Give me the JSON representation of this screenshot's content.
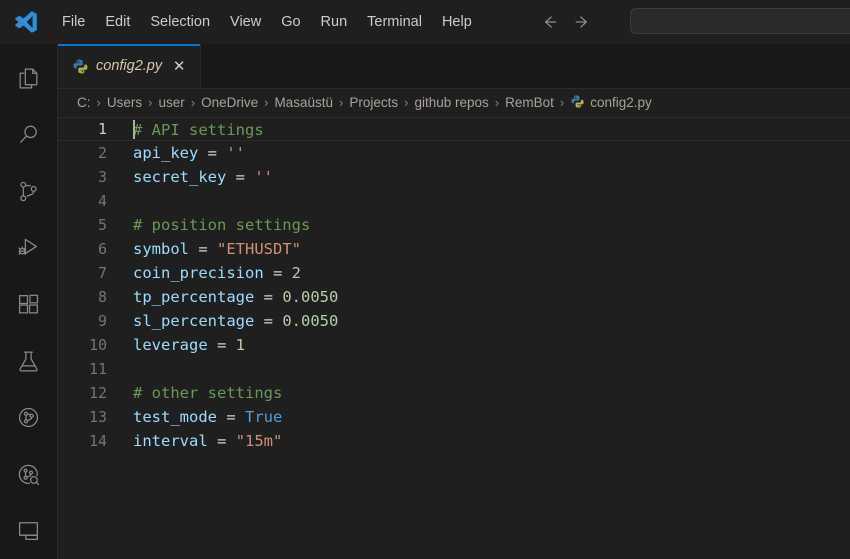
{
  "window": {
    "app_logo_icon": "vscode-logo-icon",
    "title": "config2.py"
  },
  "menubar": {
    "items": [
      {
        "label": "File",
        "name": "menu-file"
      },
      {
        "label": "Edit",
        "name": "menu-edit"
      },
      {
        "label": "Selection",
        "name": "menu-selection"
      },
      {
        "label": "View",
        "name": "menu-view"
      },
      {
        "label": "Go",
        "name": "menu-go"
      },
      {
        "label": "Run",
        "name": "menu-run"
      },
      {
        "label": "Terminal",
        "name": "menu-terminal"
      },
      {
        "label": "Help",
        "name": "menu-help"
      }
    ]
  },
  "navigation": {
    "back_icon": "arrow-left-icon",
    "forward_icon": "arrow-right-icon"
  },
  "search": {
    "value": "",
    "placeholder": ""
  },
  "activitybar": {
    "items": [
      {
        "name": "activity-explorer",
        "icon": "files-icon",
        "label": "Explorer",
        "active": false
      },
      {
        "name": "activity-search",
        "icon": "search-icon",
        "label": "Search",
        "active": false
      },
      {
        "name": "activity-source-control",
        "icon": "source-control-icon",
        "label": "Source Control",
        "active": false
      },
      {
        "name": "activity-run-debug",
        "icon": "run-and-debug-icon",
        "label": "Run and Debug",
        "active": false
      },
      {
        "name": "activity-extensions",
        "icon": "extensions-icon",
        "label": "Extensions",
        "active": false
      },
      {
        "name": "activity-testing",
        "icon": "beaker-icon",
        "label": "Testing",
        "active": false
      },
      {
        "name": "activity-git-graph",
        "icon": "git-graph-icon",
        "label": "Git Graph",
        "active": false
      },
      {
        "name": "activity-git-search",
        "icon": "git-search-icon",
        "label": "Search & Compare",
        "active": false
      },
      {
        "name": "activity-panel",
        "icon": "panel-icon",
        "label": "Panel",
        "active": false
      }
    ]
  },
  "tabs": [
    {
      "name": "tab-config2-py",
      "label": "config2.py",
      "icon": "python-file-icon",
      "close_icon": "close-icon",
      "close_glyph": "✕",
      "active": true
    }
  ],
  "breadcrumb": {
    "separator": "›",
    "items": [
      {
        "label": "C:",
        "icon": null
      },
      {
        "label": "Users",
        "icon": null
      },
      {
        "label": "user",
        "icon": null
      },
      {
        "label": "OneDrive",
        "icon": null
      },
      {
        "label": "Masaüstü",
        "icon": null
      },
      {
        "label": "Projects",
        "icon": null
      },
      {
        "label": "github repos",
        "icon": null
      },
      {
        "label": "RemBot",
        "icon": null
      },
      {
        "label": "config2.py",
        "icon": "python-file-icon"
      }
    ]
  },
  "editor": {
    "language": "python",
    "file_name": "config2.py",
    "cursor_line": 1,
    "cursor_column": 1,
    "lines": [
      {
        "num": "1",
        "current": true,
        "tokens": [
          {
            "t": "# API settings",
            "c": "comment"
          }
        ]
      },
      {
        "num": "2",
        "current": false,
        "tokens": [
          {
            "t": "api_key",
            "c": "var"
          },
          {
            "t": " = ",
            "c": "op"
          },
          {
            "t": "''",
            "c": "string"
          }
        ]
      },
      {
        "num": "3",
        "current": false,
        "tokens": [
          {
            "t": "secret_key",
            "c": "var"
          },
          {
            "t": " = ",
            "c": "op"
          },
          {
            "t": "''",
            "c": "string"
          }
        ]
      },
      {
        "num": "4",
        "current": false,
        "tokens": []
      },
      {
        "num": "5",
        "current": false,
        "tokens": [
          {
            "t": "# position settings",
            "c": "comment"
          }
        ]
      },
      {
        "num": "6",
        "current": false,
        "tokens": [
          {
            "t": "symbol",
            "c": "var"
          },
          {
            "t": " = ",
            "c": "op"
          },
          {
            "t": "\"ETHUSDT\"",
            "c": "string"
          }
        ]
      },
      {
        "num": "7",
        "current": false,
        "tokens": [
          {
            "t": "coin_precision",
            "c": "var"
          },
          {
            "t": " = ",
            "c": "op"
          },
          {
            "t": "2",
            "c": "number"
          }
        ]
      },
      {
        "num": "8",
        "current": false,
        "tokens": [
          {
            "t": "tp_percentage",
            "c": "var"
          },
          {
            "t": " = ",
            "c": "op"
          },
          {
            "t": "0.0050",
            "c": "number"
          }
        ]
      },
      {
        "num": "9",
        "current": false,
        "tokens": [
          {
            "t": "sl_percentage",
            "c": "var"
          },
          {
            "t": " = ",
            "c": "op"
          },
          {
            "t": "0.0050",
            "c": "number"
          }
        ]
      },
      {
        "num": "10",
        "current": false,
        "tokens": [
          {
            "t": "leverage",
            "c": "var"
          },
          {
            "t": " = ",
            "c": "op"
          },
          {
            "t": "1",
            "c": "number"
          }
        ]
      },
      {
        "num": "11",
        "current": false,
        "tokens": []
      },
      {
        "num": "12",
        "current": false,
        "tokens": [
          {
            "t": "# other settings",
            "c": "comment"
          }
        ]
      },
      {
        "num": "13",
        "current": false,
        "tokens": [
          {
            "t": "test_mode",
            "c": "var"
          },
          {
            "t": " = ",
            "c": "op"
          },
          {
            "t": "True",
            "c": "keyword"
          }
        ]
      },
      {
        "num": "14",
        "current": false,
        "tokens": [
          {
            "t": "interval",
            "c": "var"
          },
          {
            "t": " = ",
            "c": "op"
          },
          {
            "t": "\"15m\"",
            "c": "string"
          }
        ]
      }
    ]
  },
  "colors": {
    "accent": "#0078d4",
    "titlebar_bg": "#1f1f1f",
    "activitybar_bg": "#181818",
    "tabbar_bg": "#181818",
    "editor_bg": "#1f1f1f",
    "comment": "#6a9955",
    "variable": "#9cdcfe",
    "string": "#ce9178",
    "number": "#b5cea8",
    "keyword": "#569cd6",
    "breadcrumb_text": "#a9a295",
    "tab_label": "#d6c9a8"
  }
}
